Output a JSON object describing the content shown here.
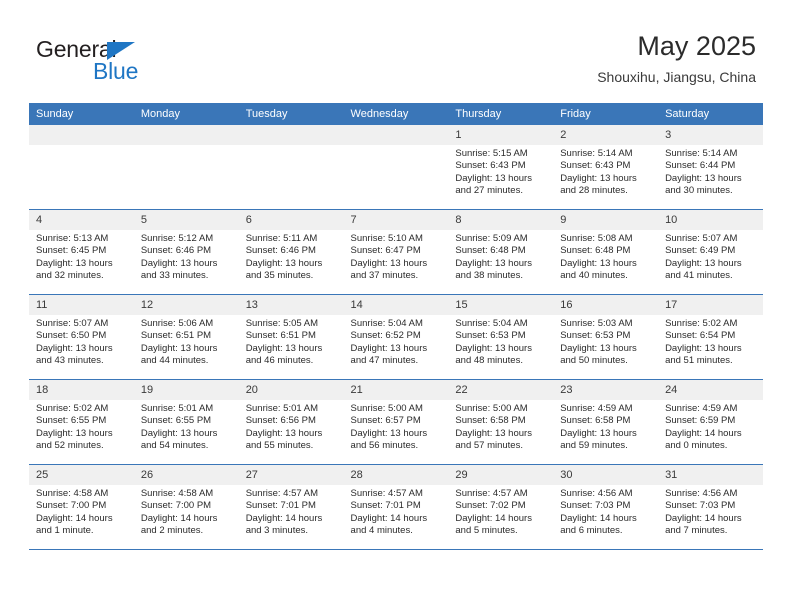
{
  "brand": {
    "name_part1": "General",
    "name_part2": "Blue",
    "triangle_icon": "triangle-icon",
    "accent_color": "#1f76c4"
  },
  "header": {
    "title": "May 2025",
    "subtitle": "Shouxihu, Jiangsu, China"
  },
  "calendar": {
    "header_color": "#3a76b8",
    "daynum_band_color": "#f0f0f0",
    "weekdays": [
      "Sunday",
      "Monday",
      "Tuesday",
      "Wednesday",
      "Thursday",
      "Friday",
      "Saturday"
    ],
    "weeks": [
      [
        {
          "day": "",
          "sunrise": "",
          "sunset": "",
          "daylight": ""
        },
        {
          "day": "",
          "sunrise": "",
          "sunset": "",
          "daylight": ""
        },
        {
          "day": "",
          "sunrise": "",
          "sunset": "",
          "daylight": ""
        },
        {
          "day": "",
          "sunrise": "",
          "sunset": "",
          "daylight": ""
        },
        {
          "day": "1",
          "sunrise": "Sunrise: 5:15 AM",
          "sunset": "Sunset: 6:43 PM",
          "daylight": "Daylight: 13 hours and 27 minutes."
        },
        {
          "day": "2",
          "sunrise": "Sunrise: 5:14 AM",
          "sunset": "Sunset: 6:43 PM",
          "daylight": "Daylight: 13 hours and 28 minutes."
        },
        {
          "day": "3",
          "sunrise": "Sunrise: 5:14 AM",
          "sunset": "Sunset: 6:44 PM",
          "daylight": "Daylight: 13 hours and 30 minutes."
        }
      ],
      [
        {
          "day": "4",
          "sunrise": "Sunrise: 5:13 AM",
          "sunset": "Sunset: 6:45 PM",
          "daylight": "Daylight: 13 hours and 32 minutes."
        },
        {
          "day": "5",
          "sunrise": "Sunrise: 5:12 AM",
          "sunset": "Sunset: 6:46 PM",
          "daylight": "Daylight: 13 hours and 33 minutes."
        },
        {
          "day": "6",
          "sunrise": "Sunrise: 5:11 AM",
          "sunset": "Sunset: 6:46 PM",
          "daylight": "Daylight: 13 hours and 35 minutes."
        },
        {
          "day": "7",
          "sunrise": "Sunrise: 5:10 AM",
          "sunset": "Sunset: 6:47 PM",
          "daylight": "Daylight: 13 hours and 37 minutes."
        },
        {
          "day": "8",
          "sunrise": "Sunrise: 5:09 AM",
          "sunset": "Sunset: 6:48 PM",
          "daylight": "Daylight: 13 hours and 38 minutes."
        },
        {
          "day": "9",
          "sunrise": "Sunrise: 5:08 AM",
          "sunset": "Sunset: 6:48 PM",
          "daylight": "Daylight: 13 hours and 40 minutes."
        },
        {
          "day": "10",
          "sunrise": "Sunrise: 5:07 AM",
          "sunset": "Sunset: 6:49 PM",
          "daylight": "Daylight: 13 hours and 41 minutes."
        }
      ],
      [
        {
          "day": "11",
          "sunrise": "Sunrise: 5:07 AM",
          "sunset": "Sunset: 6:50 PM",
          "daylight": "Daylight: 13 hours and 43 minutes."
        },
        {
          "day": "12",
          "sunrise": "Sunrise: 5:06 AM",
          "sunset": "Sunset: 6:51 PM",
          "daylight": "Daylight: 13 hours and 44 minutes."
        },
        {
          "day": "13",
          "sunrise": "Sunrise: 5:05 AM",
          "sunset": "Sunset: 6:51 PM",
          "daylight": "Daylight: 13 hours and 46 minutes."
        },
        {
          "day": "14",
          "sunrise": "Sunrise: 5:04 AM",
          "sunset": "Sunset: 6:52 PM",
          "daylight": "Daylight: 13 hours and 47 minutes."
        },
        {
          "day": "15",
          "sunrise": "Sunrise: 5:04 AM",
          "sunset": "Sunset: 6:53 PM",
          "daylight": "Daylight: 13 hours and 48 minutes."
        },
        {
          "day": "16",
          "sunrise": "Sunrise: 5:03 AM",
          "sunset": "Sunset: 6:53 PM",
          "daylight": "Daylight: 13 hours and 50 minutes."
        },
        {
          "day": "17",
          "sunrise": "Sunrise: 5:02 AM",
          "sunset": "Sunset: 6:54 PM",
          "daylight": "Daylight: 13 hours and 51 minutes."
        }
      ],
      [
        {
          "day": "18",
          "sunrise": "Sunrise: 5:02 AM",
          "sunset": "Sunset: 6:55 PM",
          "daylight": "Daylight: 13 hours and 52 minutes."
        },
        {
          "day": "19",
          "sunrise": "Sunrise: 5:01 AM",
          "sunset": "Sunset: 6:55 PM",
          "daylight": "Daylight: 13 hours and 54 minutes."
        },
        {
          "day": "20",
          "sunrise": "Sunrise: 5:01 AM",
          "sunset": "Sunset: 6:56 PM",
          "daylight": "Daylight: 13 hours and 55 minutes."
        },
        {
          "day": "21",
          "sunrise": "Sunrise: 5:00 AM",
          "sunset": "Sunset: 6:57 PM",
          "daylight": "Daylight: 13 hours and 56 minutes."
        },
        {
          "day": "22",
          "sunrise": "Sunrise: 5:00 AM",
          "sunset": "Sunset: 6:58 PM",
          "daylight": "Daylight: 13 hours and 57 minutes."
        },
        {
          "day": "23",
          "sunrise": "Sunrise: 4:59 AM",
          "sunset": "Sunset: 6:58 PM",
          "daylight": "Daylight: 13 hours and 59 minutes."
        },
        {
          "day": "24",
          "sunrise": "Sunrise: 4:59 AM",
          "sunset": "Sunset: 6:59 PM",
          "daylight": "Daylight: 14 hours and 0 minutes."
        }
      ],
      [
        {
          "day": "25",
          "sunrise": "Sunrise: 4:58 AM",
          "sunset": "Sunset: 7:00 PM",
          "daylight": "Daylight: 14 hours and 1 minute."
        },
        {
          "day": "26",
          "sunrise": "Sunrise: 4:58 AM",
          "sunset": "Sunset: 7:00 PM",
          "daylight": "Daylight: 14 hours and 2 minutes."
        },
        {
          "day": "27",
          "sunrise": "Sunrise: 4:57 AM",
          "sunset": "Sunset: 7:01 PM",
          "daylight": "Daylight: 14 hours and 3 minutes."
        },
        {
          "day": "28",
          "sunrise": "Sunrise: 4:57 AM",
          "sunset": "Sunset: 7:01 PM",
          "daylight": "Daylight: 14 hours and 4 minutes."
        },
        {
          "day": "29",
          "sunrise": "Sunrise: 4:57 AM",
          "sunset": "Sunset: 7:02 PM",
          "daylight": "Daylight: 14 hours and 5 minutes."
        },
        {
          "day": "30",
          "sunrise": "Sunrise: 4:56 AM",
          "sunset": "Sunset: 7:03 PM",
          "daylight": "Daylight: 14 hours and 6 minutes."
        },
        {
          "day": "31",
          "sunrise": "Sunrise: 4:56 AM",
          "sunset": "Sunset: 7:03 PM",
          "daylight": "Daylight: 14 hours and 7 minutes."
        }
      ]
    ]
  }
}
